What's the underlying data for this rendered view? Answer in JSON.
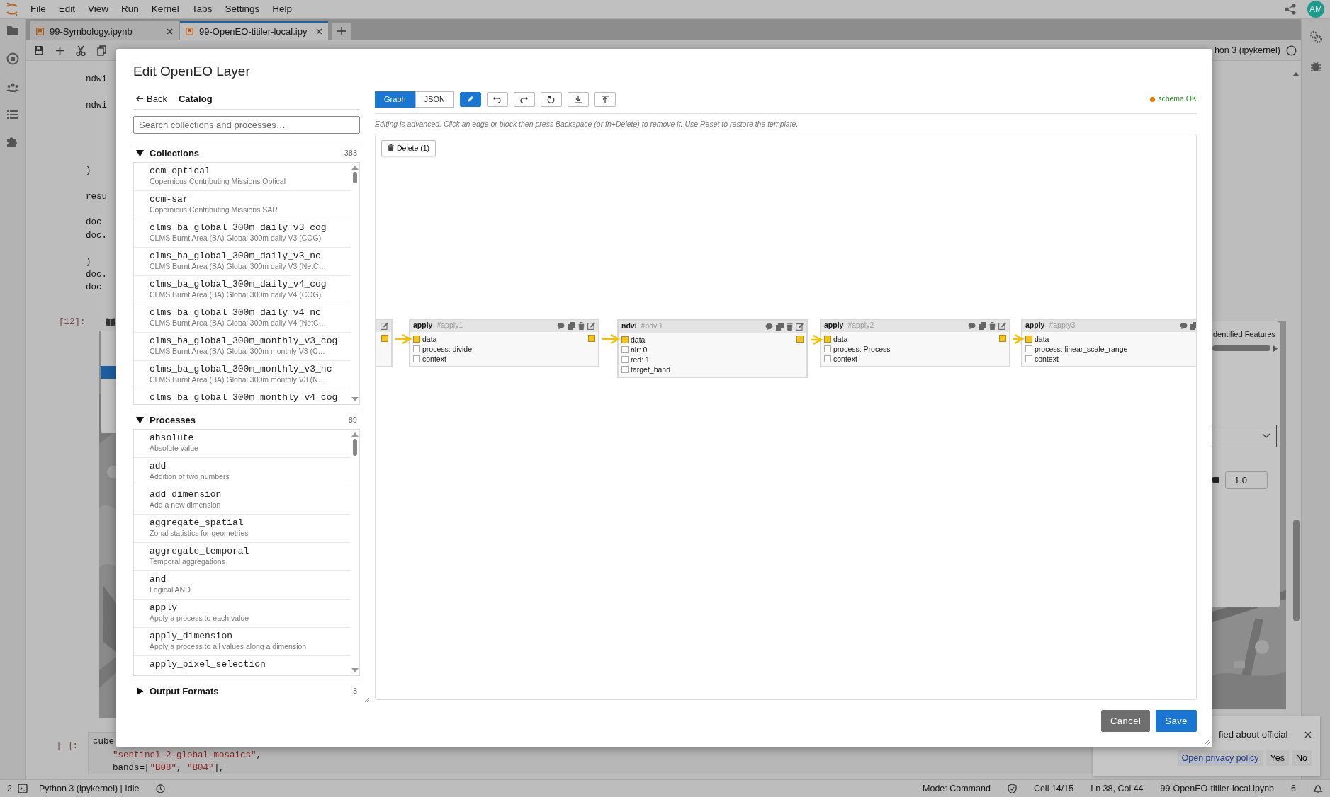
{
  "menu_bar": {
    "items": [
      "File",
      "Edit",
      "View",
      "Run",
      "Kernel",
      "Tabs",
      "Settings",
      "Help"
    ],
    "avatar": "AM"
  },
  "tabs": [
    {
      "label": "99-Symbology.ipynb",
      "selected": false
    },
    {
      "label": "99-OpenEO-titiler-local.ipy",
      "selected": true
    }
  ],
  "kernel_label": "hon 3 (ipykernel)",
  "cell_above": {
    "lines": [
      "ndwi",
      "ndwi",
      ")",
      "resu",
      "doc",
      "doc.",
      ")",
      "doc.",
      "doc"
    ],
    "prompt": "[12]:"
  },
  "cell_below": {
    "prompt": "[ ]:",
    "lines": [
      [
        {
          "text": "cube",
          "kind": "plain"
        }
      ],
      [
        {
          "text": "\"sentinel-2-global-mosaics\"",
          "kind": "string"
        },
        {
          "text": ",",
          "kind": "plain"
        }
      ],
      [
        {
          "text": "bands=[",
          "kind": "plain"
        },
        {
          "text": "\"B08\"",
          "kind": "string"
        },
        {
          "text": ", ",
          "kind": "plain"
        },
        {
          "text": "\"B04\"",
          "kind": "string"
        },
        {
          "text": "],",
          "kind": "plain"
        }
      ]
    ]
  },
  "map_widget": {
    "title": "dentified Features",
    "value": "1.0"
  },
  "notification": {
    "text": "fied about official",
    "link": "Open privacy policy",
    "buttons": [
      "Yes",
      "No"
    ]
  },
  "dialog": {
    "title": "Edit OpenEO Layer",
    "back": "Back",
    "catalog": "Catalog",
    "search": {
      "placeholder": "Search collections and processes…"
    },
    "sections": [
      {
        "title": "Collections",
        "count": "383",
        "expanded": true,
        "items": [
          {
            "name": "ccm-optical",
            "description": "Copernicus Contributing Missions Optical"
          },
          {
            "name": "ccm-sar",
            "description": "Copernicus Contributing Missions SAR"
          },
          {
            "name": "clms_ba_global_300m_daily_v3_cog",
            "description": "CLMS Burnt Area (BA) Global 300m daily V3 (COG)"
          },
          {
            "name": "clms_ba_global_300m_daily_v3_nc",
            "description": "CLMS Burnt Area (BA) Global 300m daily V3 (NetC…"
          },
          {
            "name": "clms_ba_global_300m_daily_v4_cog",
            "description": "CLMS Burnt Area (BA) Global 300m daily V4 (COG)"
          },
          {
            "name": "clms_ba_global_300m_daily_v4_nc",
            "description": "CLMS Burnt Area (BA) Global 300m daily V4 (NetC…"
          },
          {
            "name": "clms_ba_global_300m_monthly_v3_cog",
            "description": "CLMS Burnt Area (BA) Global 300m monthly V3 (C…"
          },
          {
            "name": "clms_ba_global_300m_monthly_v3_nc",
            "description": "CLMS Burnt Area (BA) Global 300m monthly V3 (N…"
          },
          {
            "name": "clms_ba_global_300m_monthly_v4_cog"
          }
        ]
      },
      {
        "title": "Processes",
        "count": "89",
        "expanded": true,
        "items": [
          {
            "name": "absolute",
            "description": "Absolute value"
          },
          {
            "name": "add",
            "description": "Addition of two numbers"
          },
          {
            "name": "add_dimension",
            "description": "Add a new dimension"
          },
          {
            "name": "aggregate_spatial",
            "description": "Zonal statistics for geometries"
          },
          {
            "name": "aggregate_temporal",
            "description": "Temporal aggregations"
          },
          {
            "name": "and",
            "description": "Logical AND"
          },
          {
            "name": "apply",
            "description": "Apply a process to each value"
          },
          {
            "name": "apply_dimension",
            "description": "Apply a process to all values along a dimension"
          },
          {
            "name": "apply_pixel_selection"
          }
        ]
      },
      {
        "title": "Output Formats",
        "count": "3",
        "expanded": false
      }
    ],
    "view_tabs": [
      {
        "label": "Graph",
        "selected": true
      },
      {
        "label": "JSON",
        "selected": false
      }
    ],
    "edit_toggle": {
      "on": true
    },
    "schema_status": "schema OK",
    "hint": "Editing is advanced. Click an edge or block then press Backspace (or fn+Delete) to remove it. Use Reset to restore the template.",
    "delete_button": "Delete (1)",
    "nodes": [
      {
        "kind": "clipped"
      },
      {
        "kind": "block",
        "title": "apply",
        "ref": "#apply1",
        "ports": [
          {
            "label": "data",
            "connected": true
          },
          {
            "label": "process: divide",
            "connected": false
          },
          {
            "label": "context",
            "connected": false
          }
        ]
      },
      {
        "kind": "block",
        "title": "ndvi",
        "ref": "#ndvi1",
        "ports": [
          {
            "label": "data",
            "connected": true
          },
          {
            "label": "nir: 0",
            "connected": false
          },
          {
            "label": "red: 1",
            "connected": false
          },
          {
            "label": "target_band",
            "connected": false
          }
        ]
      },
      {
        "kind": "block",
        "title": "apply",
        "ref": "#apply2",
        "ports": [
          {
            "label": "data",
            "connected": true
          },
          {
            "label": "process: Process",
            "connected": false
          },
          {
            "label": "context",
            "connected": false
          }
        ]
      },
      {
        "kind": "block",
        "title": "apply",
        "ref": "#apply3",
        "ports": [
          {
            "label": "data",
            "connected": true
          },
          {
            "label": "process: linear_scale_range",
            "connected": false
          },
          {
            "label": "context",
            "connected": false
          }
        ]
      }
    ],
    "buttons": [
      "Cancel",
      "Save"
    ]
  },
  "status_bar": {
    "terminals": "2",
    "kernel": "Python 3 (ipykernel) | Idle",
    "mode": "Mode: Command",
    "cell": "Cell 14/15",
    "position": "Ln 38, Col 44",
    "file": "99-OpenEO-titiler-local.ipynb",
    "notifications": "6"
  }
}
